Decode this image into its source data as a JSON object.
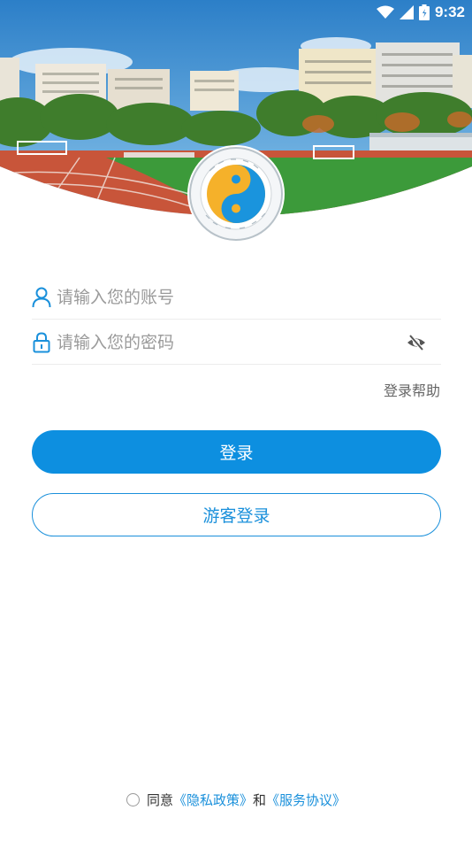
{
  "status_bar": {
    "time": "9:32",
    "icons": [
      "wifi-icon",
      "signal-icon",
      "battery-icon"
    ]
  },
  "banner": {
    "image": "campus-sports-field-photo",
    "logo": "school-emblem"
  },
  "login_form": {
    "account_placeholder": "请输入您的账号",
    "password_placeholder": "请输入您的密码",
    "account_icon": "user-icon",
    "password_icon": "lock-icon",
    "visibility_icon": "eye-off-icon",
    "help_label": "登录帮助"
  },
  "buttons": {
    "login_label": "登录",
    "guest_label": "游客登录"
  },
  "agreement": {
    "prefix": "同意",
    "privacy_link": "《隐私政策》",
    "conjunction": "和",
    "service_link": "《服务协议》"
  },
  "colors": {
    "primary": "#0d8fe0",
    "link": "#1a90db",
    "track": "#c8553a",
    "grass": "#3c9a3a"
  }
}
